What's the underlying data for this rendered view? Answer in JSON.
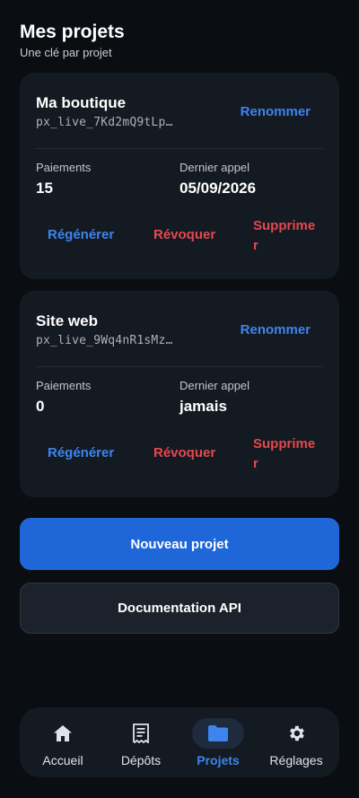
{
  "header": {
    "title": "Mes projets",
    "subtitle": "Une clé par projet"
  },
  "projects": [
    {
      "name": "Ma boutique",
      "key": "px_live_7Kd2mQ9tLp…",
      "rename_label": "Renommer",
      "payments_label": "Paiements",
      "payments_value": "15",
      "last_call_label": "Dernier appel",
      "last_call_value": "05/09/2026",
      "regenerate_label": "Régénérer",
      "revoke_label": "Révoquer",
      "delete_label": "Supprimer"
    },
    {
      "name": "Site web",
      "key": "px_live_9Wq4nR1sMz…",
      "rename_label": "Renommer",
      "payments_label": "Paiements",
      "payments_value": "0",
      "last_call_label": "Dernier appel",
      "last_call_value": "jamais",
      "regenerate_label": "Régénérer",
      "revoke_label": "Révoquer",
      "delete_label": "Supprimer"
    }
  ],
  "buttons": {
    "new_project": "Nouveau projet",
    "api_docs": "Documentation API"
  },
  "tabs": [
    {
      "label": "Accueil",
      "icon": "home-icon"
    },
    {
      "label": "Dépôts",
      "icon": "receipt-icon"
    },
    {
      "label": "Projets",
      "icon": "folder-icon",
      "active": true
    },
    {
      "label": "Réglages",
      "icon": "gear-icon"
    }
  ],
  "colors": {
    "accent": "#3d84ee",
    "danger": "#e5484d",
    "primary_button": "#1f66d9",
    "background": "#0a0d12",
    "card": "#141a22"
  }
}
